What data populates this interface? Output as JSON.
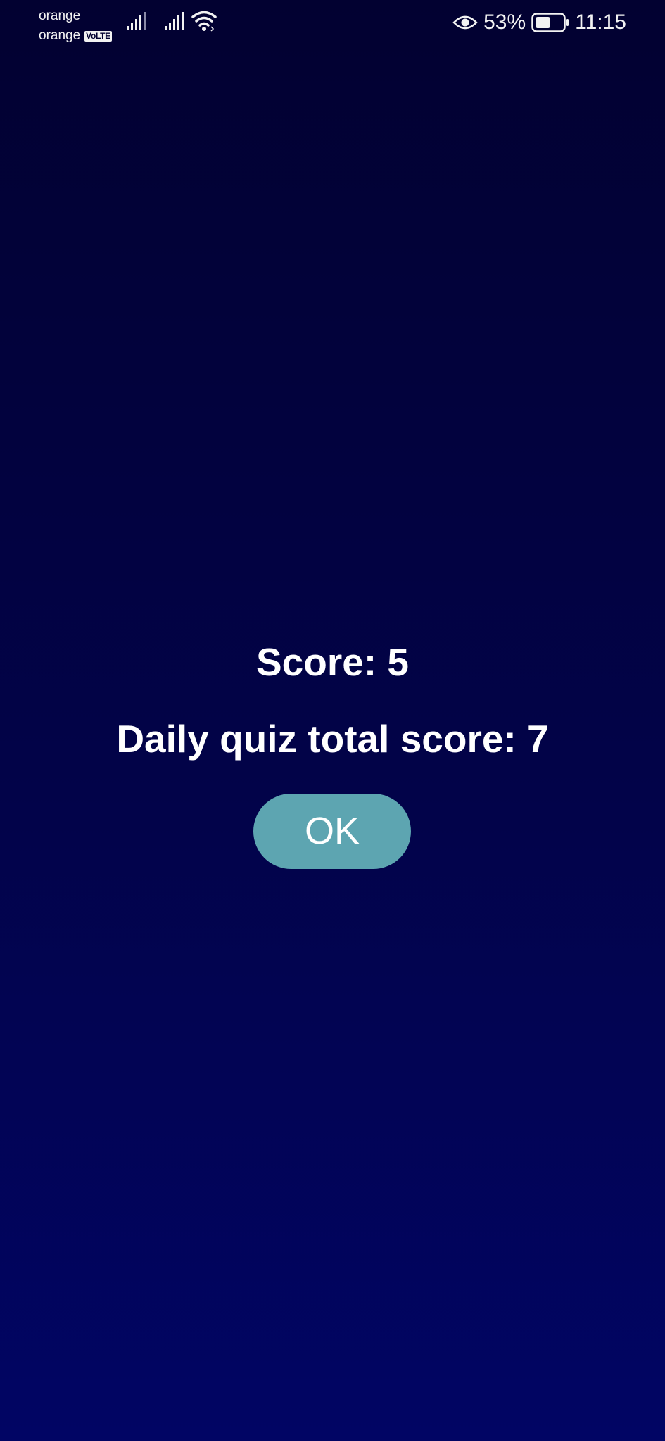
{
  "status_bar": {
    "carrier_1": "orange",
    "carrier_2": "orange",
    "volte_badge": "VoLTE",
    "battery_percent": "53%",
    "time": "11:15",
    "icons": [
      "signal-icon",
      "signal-icon",
      "wifi-icon",
      "eye-icon",
      "battery-icon"
    ]
  },
  "result": {
    "score_text": "Score: 5",
    "total_score_text": "Daily quiz total score: 7",
    "ok_label": "OK"
  },
  "colors": {
    "background_top": "#020131",
    "background_bottom": "#010564",
    "button": "#5da5b1",
    "text": "#ffffff"
  }
}
